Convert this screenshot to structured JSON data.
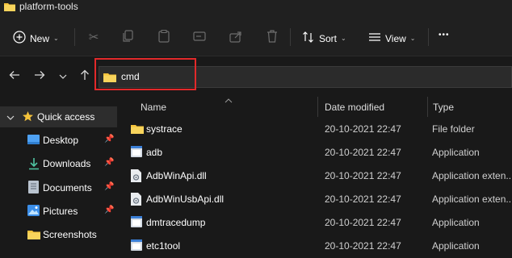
{
  "window": {
    "title": "platform-tools"
  },
  "toolbar": {
    "new_label": "New",
    "sort_label": "Sort",
    "view_label": "View",
    "more_label": "•••"
  },
  "address": {
    "value": "cmd"
  },
  "sidebar": {
    "items": [
      {
        "label": "Quick access",
        "icon": "star-icon",
        "pinned": false
      },
      {
        "label": "Desktop",
        "icon": "desktop-icon",
        "pinned": true
      },
      {
        "label": "Downloads",
        "icon": "download-icon",
        "pinned": true
      },
      {
        "label": "Documents",
        "icon": "document-icon",
        "pinned": true
      },
      {
        "label": "Pictures",
        "icon": "picture-icon",
        "pinned": true
      },
      {
        "label": "Screenshots",
        "icon": "folder-icon",
        "pinned": false
      }
    ]
  },
  "columns": {
    "name": "Name",
    "date": "Date modified",
    "type": "Type"
  },
  "files": [
    {
      "name": "systrace",
      "date": "20-10-2021 22:47",
      "type": "File folder",
      "icon": "folder-icon"
    },
    {
      "name": "adb",
      "date": "20-10-2021 22:47",
      "type": "Application",
      "icon": "application-icon"
    },
    {
      "name": "AdbWinApi.dll",
      "date": "20-10-2021 22:47",
      "type": "Application exten...",
      "icon": "dll-icon"
    },
    {
      "name": "AdbWinUsbApi.dll",
      "date": "20-10-2021 22:47",
      "type": "Application exten...",
      "icon": "dll-icon"
    },
    {
      "name": "dmtracedump",
      "date": "20-10-2021 22:47",
      "type": "Application",
      "icon": "application-icon"
    },
    {
      "name": "etc1tool",
      "date": "20-10-2021 22:47",
      "type": "Application",
      "icon": "application-icon"
    }
  ],
  "colors": {
    "background": "#191919",
    "chrome": "#202020",
    "highlight": "#e2292a",
    "folder": "#f5c33b",
    "accent": "#4ea1f3"
  }
}
